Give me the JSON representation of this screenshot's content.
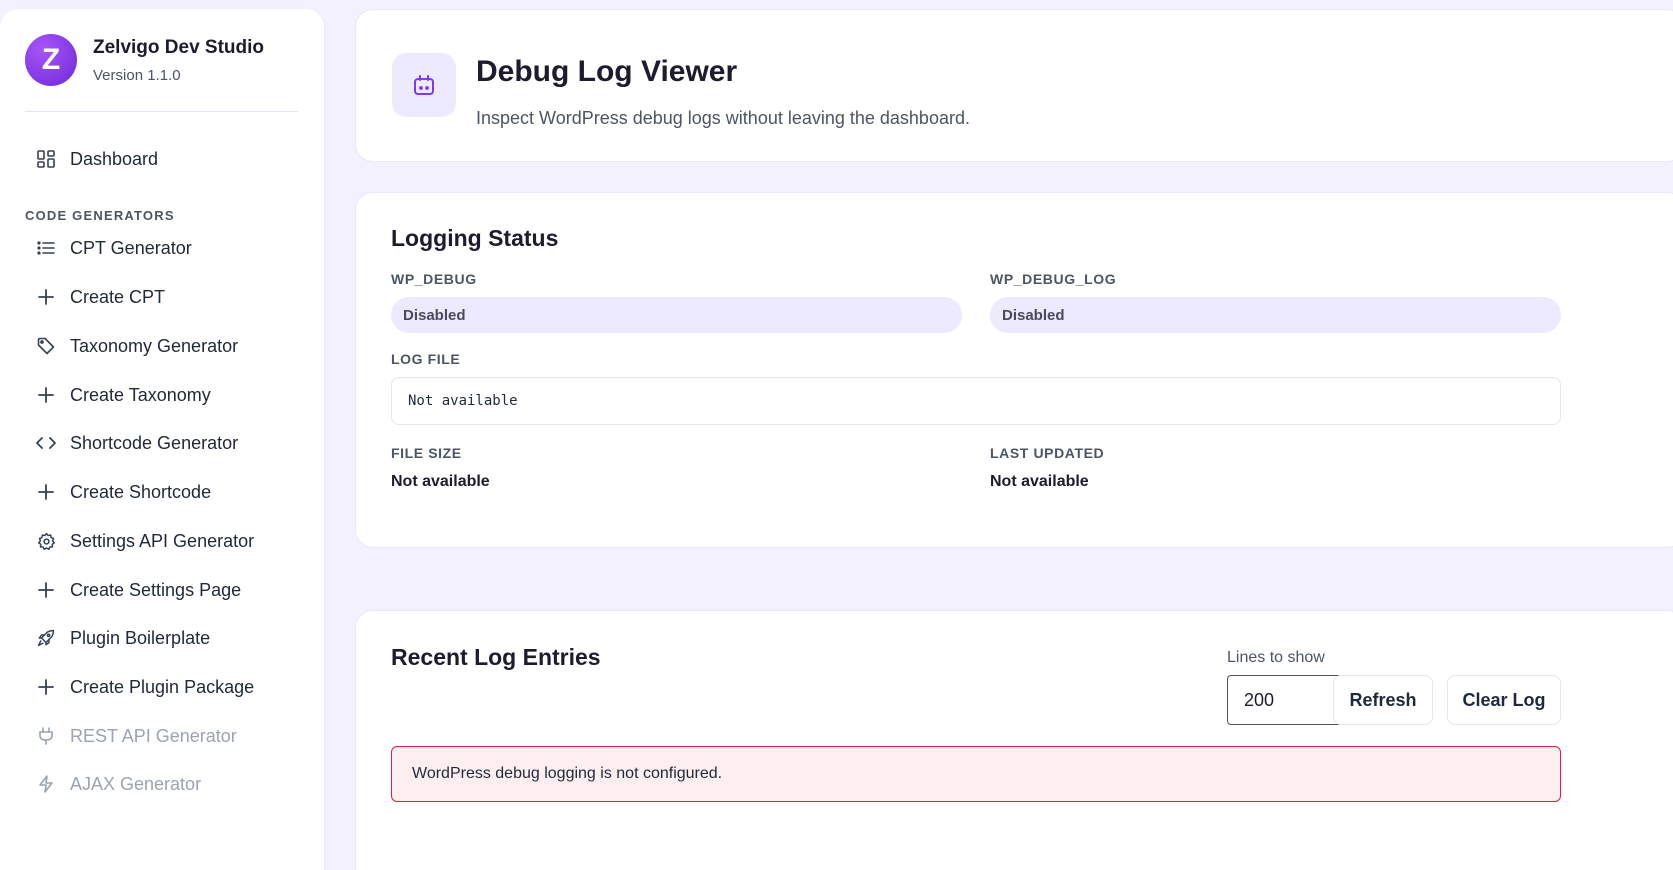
{
  "brand": {
    "logo_letter": "Z",
    "name": "Zelvigo Dev Studio",
    "version": "Version 1.1.0"
  },
  "sidebar": {
    "dashboard": {
      "label": "Dashboard",
      "icon": "dashboard-grid-icon"
    },
    "section_label": "CODE GENERATORS",
    "items": [
      {
        "label": "CPT Generator",
        "icon": "list-icon",
        "enabled": true
      },
      {
        "label": "Create CPT",
        "icon": "plus-icon",
        "enabled": true
      },
      {
        "label": "Taxonomy Generator",
        "icon": "tag-icon",
        "enabled": true
      },
      {
        "label": "Create Taxonomy",
        "icon": "plus-icon",
        "enabled": true
      },
      {
        "label": "Shortcode Generator",
        "icon": "code-icon",
        "enabled": true
      },
      {
        "label": "Create Shortcode",
        "icon": "plus-icon",
        "enabled": true
      },
      {
        "label": "Settings API Generator",
        "icon": "gear-icon",
        "enabled": true
      },
      {
        "label": "Create Settings Page",
        "icon": "plus-icon",
        "enabled": true
      },
      {
        "label": "Plugin Boilerplate",
        "icon": "rocket-icon",
        "enabled": true
      },
      {
        "label": "Create Plugin Package",
        "icon": "plus-icon",
        "enabled": true
      },
      {
        "label": "REST API Generator",
        "icon": "plug-icon",
        "enabled": false
      },
      {
        "label": "AJAX Generator",
        "icon": "bolt-icon",
        "enabled": false
      }
    ]
  },
  "header": {
    "icon": "calendar-bug-icon",
    "title": "Debug Log Viewer",
    "subtitle": "Inspect WordPress debug logs without leaving the dashboard."
  },
  "status": {
    "title": "Logging Status",
    "wp_debug": {
      "label": "WP_DEBUG",
      "value": "Disabled"
    },
    "wp_debug_log": {
      "label": "WP_DEBUG_LOG",
      "value": "Disabled"
    },
    "log_file": {
      "label": "LOG FILE",
      "value": "Not available"
    },
    "file_size": {
      "label": "FILE SIZE",
      "value": "Not available"
    },
    "last_updated": {
      "label": "LAST UPDATED",
      "value": "Not available"
    }
  },
  "log": {
    "title": "Recent Log Entries",
    "lines_label": "Lines to show",
    "lines_value": "200",
    "refresh_label": "Refresh",
    "clear_label": "Clear Log",
    "alert": "WordPress debug logging is not configured."
  },
  "colors": {
    "accent": "#7c3aed",
    "pill_bg": "#ede9fe",
    "page_bg": "#f3f1fd",
    "alert_border": "#e11d48",
    "alert_bg": "#fdeef0"
  }
}
